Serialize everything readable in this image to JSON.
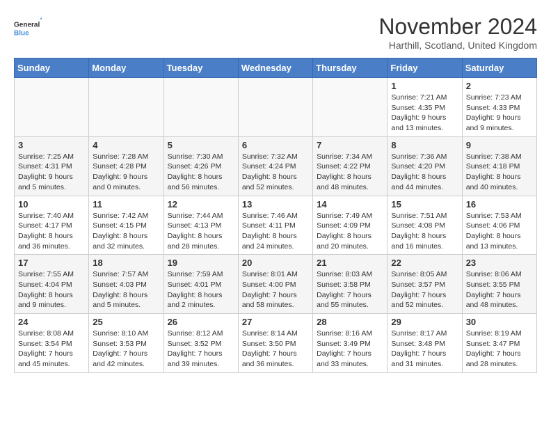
{
  "header": {
    "logo_general": "General",
    "logo_blue": "Blue",
    "month_title": "November 2024",
    "location": "Harthill, Scotland, United Kingdom"
  },
  "days_of_week": [
    "Sunday",
    "Monday",
    "Tuesday",
    "Wednesday",
    "Thursday",
    "Friday",
    "Saturday"
  ],
  "weeks": [
    [
      {
        "day": "",
        "info": ""
      },
      {
        "day": "",
        "info": ""
      },
      {
        "day": "",
        "info": ""
      },
      {
        "day": "",
        "info": ""
      },
      {
        "day": "",
        "info": ""
      },
      {
        "day": "1",
        "info": "Sunrise: 7:21 AM\nSunset: 4:35 PM\nDaylight: 9 hours and 13 minutes."
      },
      {
        "day": "2",
        "info": "Sunrise: 7:23 AM\nSunset: 4:33 PM\nDaylight: 9 hours and 9 minutes."
      }
    ],
    [
      {
        "day": "3",
        "info": "Sunrise: 7:25 AM\nSunset: 4:31 PM\nDaylight: 9 hours and 5 minutes."
      },
      {
        "day": "4",
        "info": "Sunrise: 7:28 AM\nSunset: 4:28 PM\nDaylight: 9 hours and 0 minutes."
      },
      {
        "day": "5",
        "info": "Sunrise: 7:30 AM\nSunset: 4:26 PM\nDaylight: 8 hours and 56 minutes."
      },
      {
        "day": "6",
        "info": "Sunrise: 7:32 AM\nSunset: 4:24 PM\nDaylight: 8 hours and 52 minutes."
      },
      {
        "day": "7",
        "info": "Sunrise: 7:34 AM\nSunset: 4:22 PM\nDaylight: 8 hours and 48 minutes."
      },
      {
        "day": "8",
        "info": "Sunrise: 7:36 AM\nSunset: 4:20 PM\nDaylight: 8 hours and 44 minutes."
      },
      {
        "day": "9",
        "info": "Sunrise: 7:38 AM\nSunset: 4:18 PM\nDaylight: 8 hours and 40 minutes."
      }
    ],
    [
      {
        "day": "10",
        "info": "Sunrise: 7:40 AM\nSunset: 4:17 PM\nDaylight: 8 hours and 36 minutes."
      },
      {
        "day": "11",
        "info": "Sunrise: 7:42 AM\nSunset: 4:15 PM\nDaylight: 8 hours and 32 minutes."
      },
      {
        "day": "12",
        "info": "Sunrise: 7:44 AM\nSunset: 4:13 PM\nDaylight: 8 hours and 28 minutes."
      },
      {
        "day": "13",
        "info": "Sunrise: 7:46 AM\nSunset: 4:11 PM\nDaylight: 8 hours and 24 minutes."
      },
      {
        "day": "14",
        "info": "Sunrise: 7:49 AM\nSunset: 4:09 PM\nDaylight: 8 hours and 20 minutes."
      },
      {
        "day": "15",
        "info": "Sunrise: 7:51 AM\nSunset: 4:08 PM\nDaylight: 8 hours and 16 minutes."
      },
      {
        "day": "16",
        "info": "Sunrise: 7:53 AM\nSunset: 4:06 PM\nDaylight: 8 hours and 13 minutes."
      }
    ],
    [
      {
        "day": "17",
        "info": "Sunrise: 7:55 AM\nSunset: 4:04 PM\nDaylight: 8 hours and 9 minutes."
      },
      {
        "day": "18",
        "info": "Sunrise: 7:57 AM\nSunset: 4:03 PM\nDaylight: 8 hours and 5 minutes."
      },
      {
        "day": "19",
        "info": "Sunrise: 7:59 AM\nSunset: 4:01 PM\nDaylight: 8 hours and 2 minutes."
      },
      {
        "day": "20",
        "info": "Sunrise: 8:01 AM\nSunset: 4:00 PM\nDaylight: 7 hours and 58 minutes."
      },
      {
        "day": "21",
        "info": "Sunrise: 8:03 AM\nSunset: 3:58 PM\nDaylight: 7 hours and 55 minutes."
      },
      {
        "day": "22",
        "info": "Sunrise: 8:05 AM\nSunset: 3:57 PM\nDaylight: 7 hours and 52 minutes."
      },
      {
        "day": "23",
        "info": "Sunrise: 8:06 AM\nSunset: 3:55 PM\nDaylight: 7 hours and 48 minutes."
      }
    ],
    [
      {
        "day": "24",
        "info": "Sunrise: 8:08 AM\nSunset: 3:54 PM\nDaylight: 7 hours and 45 minutes."
      },
      {
        "day": "25",
        "info": "Sunrise: 8:10 AM\nSunset: 3:53 PM\nDaylight: 7 hours and 42 minutes."
      },
      {
        "day": "26",
        "info": "Sunrise: 8:12 AM\nSunset: 3:52 PM\nDaylight: 7 hours and 39 minutes."
      },
      {
        "day": "27",
        "info": "Sunrise: 8:14 AM\nSunset: 3:50 PM\nDaylight: 7 hours and 36 minutes."
      },
      {
        "day": "28",
        "info": "Sunrise: 8:16 AM\nSunset: 3:49 PM\nDaylight: 7 hours and 33 minutes."
      },
      {
        "day": "29",
        "info": "Sunrise: 8:17 AM\nSunset: 3:48 PM\nDaylight: 7 hours and 31 minutes."
      },
      {
        "day": "30",
        "info": "Sunrise: 8:19 AM\nSunset: 3:47 PM\nDaylight: 7 hours and 28 minutes."
      }
    ]
  ]
}
